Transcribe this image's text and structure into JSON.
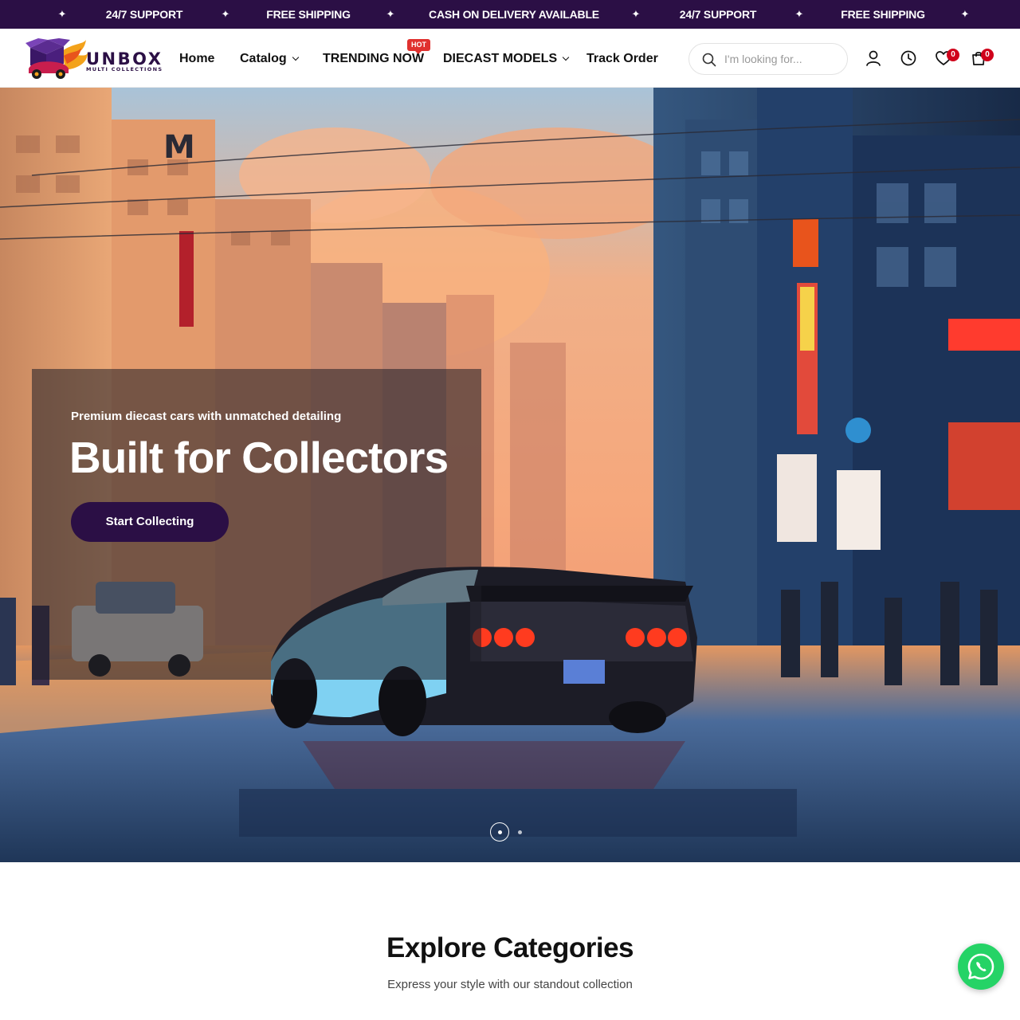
{
  "announcement": {
    "items": [
      "24/7 SUPPORT",
      "FREE SHIPPING",
      "CASH ON DELIVERY AVAILABLE",
      "24/7 SUPPORT",
      "FREE SHIPPING"
    ],
    "separator": "✦"
  },
  "brand": {
    "name": "UNBOX",
    "tagline": "MULTI COLLECTIONS",
    "primary_color": "#2b0f45"
  },
  "nav": {
    "home": "Home",
    "catalog": "Catalog",
    "trending": "TRENDING NOW",
    "hot_badge": "HOT",
    "diecast": "DIECAST MODELS",
    "track": "Track Order"
  },
  "search": {
    "placeholder": "I'm looking for..."
  },
  "header_icons": {
    "account": "user-icon",
    "history": "clock-icon",
    "wishlist": "heart-icon",
    "wishlist_count": "0",
    "cart": "shopping-bag-icon",
    "cart_count": "0"
  },
  "hero": {
    "subtitle": "Premium diecast cars with unmatched detailing",
    "title": "Built for Collectors",
    "cta": "Start Collecting",
    "slide_count": 2,
    "active_slide": 1
  },
  "categories": {
    "title": "Explore Categories",
    "subtitle": "Express your style with our standout collection"
  },
  "whatsapp": {
    "icon": "whatsapp-icon",
    "color": "#25d366"
  }
}
